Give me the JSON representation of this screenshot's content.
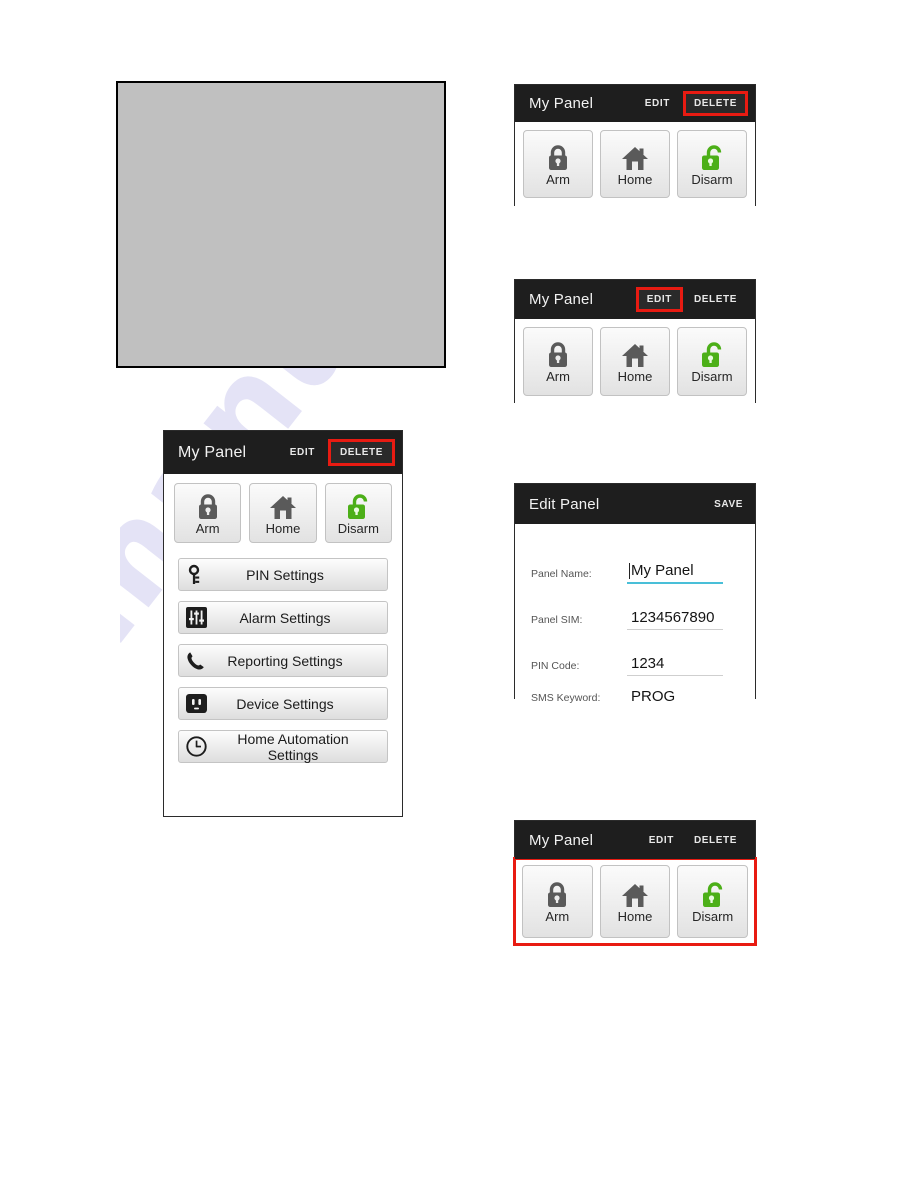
{
  "document": {
    "watermark": "manualshive.com"
  },
  "placeholder_box": {
    "name": "blank-image-placeholder"
  },
  "panels": {
    "top_right": {
      "title": "My Panel",
      "actions": {
        "edit": "EDIT",
        "delete": "DELETE"
      },
      "highlight": "delete",
      "modes": [
        {
          "label": "Arm",
          "icon": "lock-closed-icon",
          "color": "#5a5a5a"
        },
        {
          "label": "Home",
          "icon": "home-icon",
          "color": "#5a5a5a"
        },
        {
          "label": "Disarm",
          "icon": "lock-open-icon",
          "color": "#4caf18"
        }
      ]
    },
    "mid_right": {
      "title": "My Panel",
      "actions": {
        "edit": "EDIT",
        "delete": "DELETE"
      },
      "highlight": "edit",
      "modes": [
        {
          "label": "Arm",
          "icon": "lock-closed-icon",
          "color": "#5a5a5a"
        },
        {
          "label": "Home",
          "icon": "home-icon",
          "color": "#5a5a5a"
        },
        {
          "label": "Disarm",
          "icon": "lock-open-icon",
          "color": "#4caf18"
        }
      ]
    },
    "edit_panel": {
      "title": "Edit Panel",
      "actions": {
        "save": "SAVE"
      },
      "fields": [
        {
          "label": "Panel Name:",
          "value": "My Panel",
          "focused": true
        },
        {
          "label": "Panel SIM:",
          "value": "1234567890",
          "focused": false
        },
        {
          "label": "PIN Code:",
          "value": "1234",
          "focused": false
        },
        {
          "label": "SMS Keyword:",
          "value": "PROG",
          "focused": false
        }
      ]
    },
    "bottom_right": {
      "title": "My Panel",
      "actions": {
        "edit": "EDIT",
        "delete": "DELETE"
      },
      "highlight": "mode-row",
      "modes": [
        {
          "label": "Arm",
          "icon": "lock-closed-icon",
          "color": "#5a5a5a"
        },
        {
          "label": "Home",
          "icon": "home-icon",
          "color": "#5a5a5a"
        },
        {
          "label": "Disarm",
          "icon": "lock-open-icon",
          "color": "#4caf18"
        }
      ]
    },
    "main_left": {
      "title": "My Panel",
      "actions": {
        "edit": "EDIT",
        "delete": "DELETE"
      },
      "highlight": "delete",
      "modes": [
        {
          "label": "Arm",
          "icon": "lock-closed-icon",
          "color": "#5a5a5a"
        },
        {
          "label": "Home",
          "icon": "home-icon",
          "color": "#5a5a5a"
        },
        {
          "label": "Disarm",
          "icon": "lock-open-icon",
          "color": "#4caf18"
        }
      ],
      "settings": [
        {
          "label": "PIN Settings",
          "icon": "key-icon"
        },
        {
          "label": "Alarm Settings",
          "icon": "sliders-icon"
        },
        {
          "label": "Reporting Settings",
          "icon": "phone-icon"
        },
        {
          "label": "Device Settings",
          "icon": "power-outlet-icon"
        },
        {
          "label": "Home Automation Settings",
          "icon": "clock-icon"
        }
      ]
    }
  },
  "colors": {
    "titlebar": "#1e1e1e",
    "highlight": "#e81b12",
    "disarm_green": "#4caf18",
    "focus_underline": "#49bfd8"
  }
}
